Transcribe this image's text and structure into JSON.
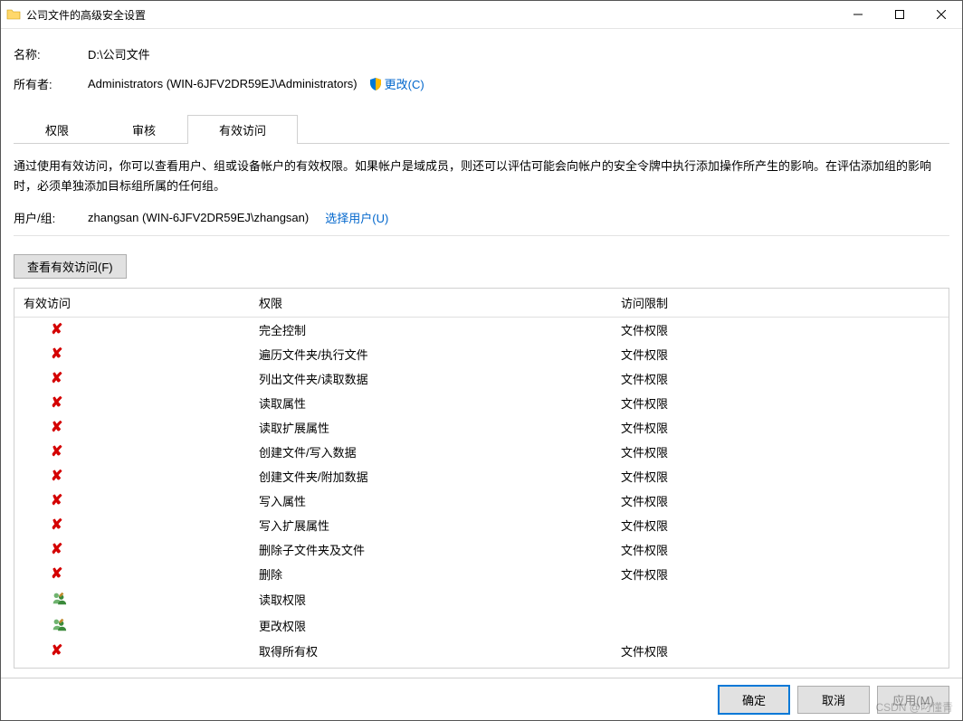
{
  "window": {
    "title": "公司文件的高级安全设置"
  },
  "header": {
    "name_label": "名称:",
    "name_value": "D:\\公司文件",
    "owner_label": "所有者:",
    "owner_value": "Administrators (WIN-6JFV2DR59EJ\\Administrators)",
    "change_link": "更改(C)"
  },
  "tabs": {
    "permissions": "权限",
    "audit": "审核",
    "effective": "有效访问"
  },
  "description": "通过使用有效访问，你可以查看用户、组或设备帐户的有效权限。如果帐户是域成员，则还可以评估可能会向帐户的安全令牌中执行添加操作所产生的影响。在评估添加组的影响时，必须单独添加目标组所属的任何组。",
  "usergroup": {
    "label": "用户/组:",
    "value": "zhangsan (WIN-6JFV2DR59EJ\\zhangsan)",
    "select_link": "选择用户(U)"
  },
  "view_button": "查看有效访问(F)",
  "table": {
    "headers": {
      "col1": "有效访问",
      "col2": "权限",
      "col3": "访问限制"
    },
    "rows": [
      {
        "status": "deny",
        "perm": "完全控制",
        "limit": "文件权限"
      },
      {
        "status": "deny",
        "perm": "遍历文件夹/执行文件",
        "limit": "文件权限"
      },
      {
        "status": "deny",
        "perm": "列出文件夹/读取数据",
        "limit": "文件权限"
      },
      {
        "status": "deny",
        "perm": "读取属性",
        "limit": "文件权限"
      },
      {
        "status": "deny",
        "perm": "读取扩展属性",
        "limit": "文件权限"
      },
      {
        "status": "deny",
        "perm": "创建文件/写入数据",
        "limit": "文件权限"
      },
      {
        "status": "deny",
        "perm": "创建文件夹/附加数据",
        "limit": "文件权限"
      },
      {
        "status": "deny",
        "perm": "写入属性",
        "limit": "文件权限"
      },
      {
        "status": "deny",
        "perm": "写入扩展属性",
        "limit": "文件权限"
      },
      {
        "status": "deny",
        "perm": "删除子文件夹及文件",
        "limit": "文件权限"
      },
      {
        "status": "deny",
        "perm": "删除",
        "limit": "文件权限"
      },
      {
        "status": "group",
        "perm": "读取权限",
        "limit": ""
      },
      {
        "status": "group",
        "perm": "更改权限",
        "limit": ""
      },
      {
        "status": "deny",
        "perm": "取得所有权",
        "limit": "文件权限"
      }
    ]
  },
  "footer": {
    "ok": "确定",
    "cancel": "取消",
    "apply": "应用(M)"
  },
  "watermark": "CSDN @叼懂青"
}
